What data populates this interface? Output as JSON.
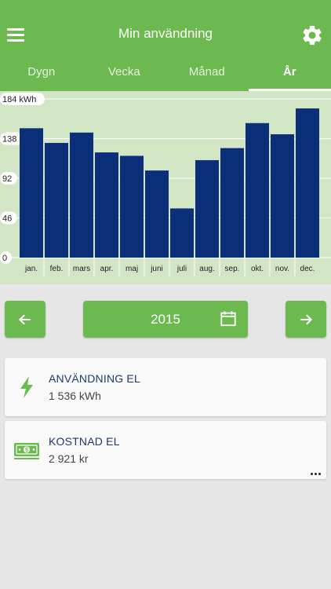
{
  "header": {
    "title": "Min användning"
  },
  "tabs": [
    {
      "label": "Dygn"
    },
    {
      "label": "Vecka"
    },
    {
      "label": "Månad"
    },
    {
      "label": "År"
    }
  ],
  "chart_data": {
    "type": "bar",
    "categories": [
      "jan.",
      "feb.",
      "mars",
      "apr.",
      "maj",
      "juni",
      "juli",
      "aug.",
      "sep.",
      "okt.",
      "nov.",
      "dec."
    ],
    "values": [
      150,
      133,
      145,
      122,
      118,
      101,
      57,
      113,
      127,
      156,
      143,
      173
    ],
    "y_ticks": [
      "184 kWh",
      "138",
      "92",
      "46",
      "0"
    ],
    "ylim": [
      0,
      184
    ],
    "grid": true,
    "bar_color": "#0b2f78",
    "background_color": "#d2e6c5"
  },
  "navigation": {
    "year": "2015"
  },
  "cards": {
    "usage": {
      "title": "ANVÄNDNING EL",
      "value": "1 536 kWh"
    },
    "cost": {
      "title": "KOSTNAD EL",
      "value": "2 921 kr"
    }
  },
  "colors": {
    "primary": "#6bb94f",
    "bar": "#0b2f78",
    "card_title": "#1a3a6b"
  }
}
